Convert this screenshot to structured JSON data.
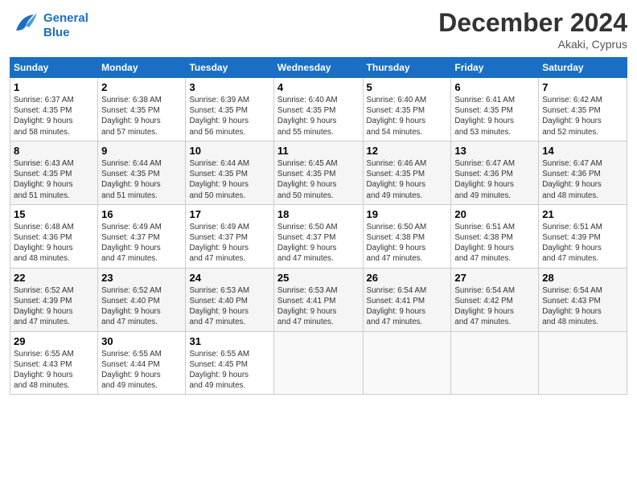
{
  "logo": {
    "line1": "General",
    "line2": "Blue"
  },
  "title": "December 2024",
  "location": "Akaki, Cyprus",
  "days_of_week": [
    "Sunday",
    "Monday",
    "Tuesday",
    "Wednesday",
    "Thursday",
    "Friday",
    "Saturday"
  ],
  "weeks": [
    [
      {
        "day": 1,
        "info": "Sunrise: 6:37 AM\nSunset: 4:35 PM\nDaylight: 9 hours\nand 58 minutes."
      },
      {
        "day": 2,
        "info": "Sunrise: 6:38 AM\nSunset: 4:35 PM\nDaylight: 9 hours\nand 57 minutes."
      },
      {
        "day": 3,
        "info": "Sunrise: 6:39 AM\nSunset: 4:35 PM\nDaylight: 9 hours\nand 56 minutes."
      },
      {
        "day": 4,
        "info": "Sunrise: 6:40 AM\nSunset: 4:35 PM\nDaylight: 9 hours\nand 55 minutes."
      },
      {
        "day": 5,
        "info": "Sunrise: 6:40 AM\nSunset: 4:35 PM\nDaylight: 9 hours\nand 54 minutes."
      },
      {
        "day": 6,
        "info": "Sunrise: 6:41 AM\nSunset: 4:35 PM\nDaylight: 9 hours\nand 53 minutes."
      },
      {
        "day": 7,
        "info": "Sunrise: 6:42 AM\nSunset: 4:35 PM\nDaylight: 9 hours\nand 52 minutes."
      }
    ],
    [
      {
        "day": 8,
        "info": "Sunrise: 6:43 AM\nSunset: 4:35 PM\nDaylight: 9 hours\nand 51 minutes."
      },
      {
        "day": 9,
        "info": "Sunrise: 6:44 AM\nSunset: 4:35 PM\nDaylight: 9 hours\nand 51 minutes."
      },
      {
        "day": 10,
        "info": "Sunrise: 6:44 AM\nSunset: 4:35 PM\nDaylight: 9 hours\nand 50 minutes."
      },
      {
        "day": 11,
        "info": "Sunrise: 6:45 AM\nSunset: 4:35 PM\nDaylight: 9 hours\nand 50 minutes."
      },
      {
        "day": 12,
        "info": "Sunrise: 6:46 AM\nSunset: 4:35 PM\nDaylight: 9 hours\nand 49 minutes."
      },
      {
        "day": 13,
        "info": "Sunrise: 6:47 AM\nSunset: 4:36 PM\nDaylight: 9 hours\nand 49 minutes."
      },
      {
        "day": 14,
        "info": "Sunrise: 6:47 AM\nSunset: 4:36 PM\nDaylight: 9 hours\nand 48 minutes."
      }
    ],
    [
      {
        "day": 15,
        "info": "Sunrise: 6:48 AM\nSunset: 4:36 PM\nDaylight: 9 hours\nand 48 minutes."
      },
      {
        "day": 16,
        "info": "Sunrise: 6:49 AM\nSunset: 4:37 PM\nDaylight: 9 hours\nand 47 minutes."
      },
      {
        "day": 17,
        "info": "Sunrise: 6:49 AM\nSunset: 4:37 PM\nDaylight: 9 hours\nand 47 minutes."
      },
      {
        "day": 18,
        "info": "Sunrise: 6:50 AM\nSunset: 4:37 PM\nDaylight: 9 hours\nand 47 minutes."
      },
      {
        "day": 19,
        "info": "Sunrise: 6:50 AM\nSunset: 4:38 PM\nDaylight: 9 hours\nand 47 minutes."
      },
      {
        "day": 20,
        "info": "Sunrise: 6:51 AM\nSunset: 4:38 PM\nDaylight: 9 hours\nand 47 minutes."
      },
      {
        "day": 21,
        "info": "Sunrise: 6:51 AM\nSunset: 4:39 PM\nDaylight: 9 hours\nand 47 minutes."
      }
    ],
    [
      {
        "day": 22,
        "info": "Sunrise: 6:52 AM\nSunset: 4:39 PM\nDaylight: 9 hours\nand 47 minutes."
      },
      {
        "day": 23,
        "info": "Sunrise: 6:52 AM\nSunset: 4:40 PM\nDaylight: 9 hours\nand 47 minutes."
      },
      {
        "day": 24,
        "info": "Sunrise: 6:53 AM\nSunset: 4:40 PM\nDaylight: 9 hours\nand 47 minutes."
      },
      {
        "day": 25,
        "info": "Sunrise: 6:53 AM\nSunset: 4:41 PM\nDaylight: 9 hours\nand 47 minutes."
      },
      {
        "day": 26,
        "info": "Sunrise: 6:54 AM\nSunset: 4:41 PM\nDaylight: 9 hours\nand 47 minutes."
      },
      {
        "day": 27,
        "info": "Sunrise: 6:54 AM\nSunset: 4:42 PM\nDaylight: 9 hours\nand 47 minutes."
      },
      {
        "day": 28,
        "info": "Sunrise: 6:54 AM\nSunset: 4:43 PM\nDaylight: 9 hours\nand 48 minutes."
      }
    ],
    [
      {
        "day": 29,
        "info": "Sunrise: 6:55 AM\nSunset: 4:43 PM\nDaylight: 9 hours\nand 48 minutes."
      },
      {
        "day": 30,
        "info": "Sunrise: 6:55 AM\nSunset: 4:44 PM\nDaylight: 9 hours\nand 49 minutes."
      },
      {
        "day": 31,
        "info": "Sunrise: 6:55 AM\nSunset: 4:45 PM\nDaylight: 9 hours\nand 49 minutes."
      },
      null,
      null,
      null,
      null
    ]
  ]
}
